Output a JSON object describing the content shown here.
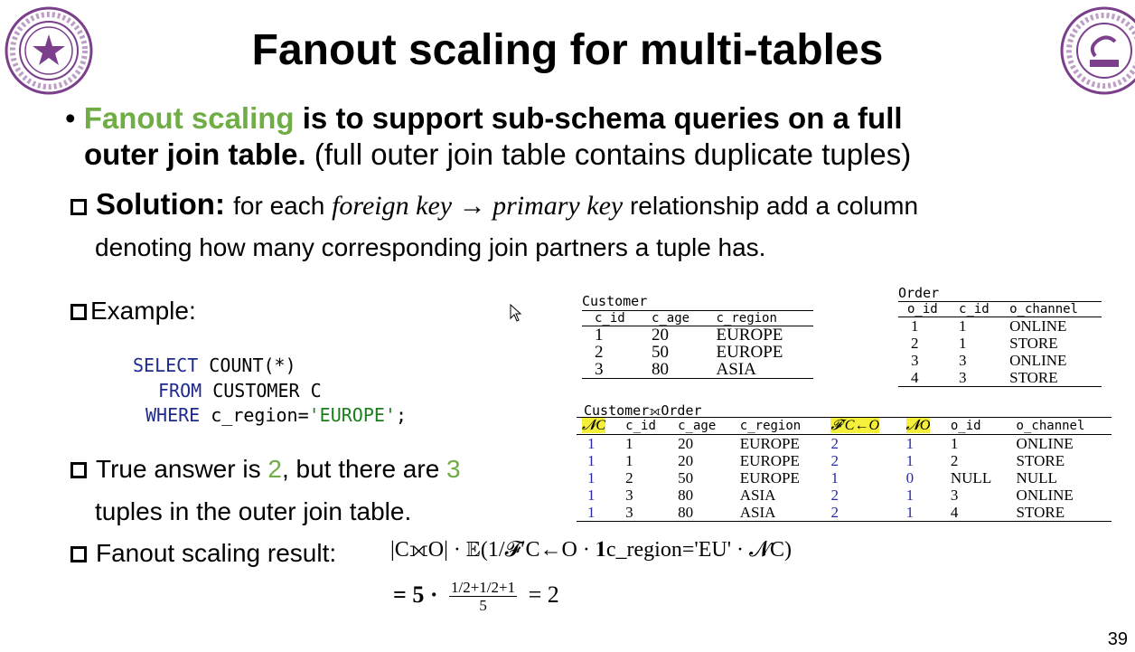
{
  "title": "Fanout scaling for multi-tables",
  "bullet": {
    "highlight": "Fanout scaling",
    "bold_rest": " is to support sub-schema queries on a full",
    "bold_line2": "outer join table.",
    "normal_line2": " (full outer join table contains duplicate tuples)"
  },
  "solution": {
    "label": "Solution:",
    "text_before": "for each ",
    "math": "foreign key → primary key",
    "text_after": " relationship add a column",
    "line2": "denoting how many corresponding join partners a tuple has."
  },
  "example_label": "Example:",
  "sql": {
    "line1_kw": "SELECT",
    "line1_rest": " COUNT(*)",
    "line2_kw": "FROM",
    "line2_rest": " CUSTOMER C",
    "line3_kw": "WHERE",
    "line3_rest": " c_region=",
    "line3_str": "'EUROPE'",
    "line3_end": ";"
  },
  "true_answer": {
    "pre": "True answer is ",
    "n1": "2",
    "mid": ", but there are ",
    "n2": "3",
    "line2": "tuples in the outer join table."
  },
  "fanout_result": {
    "label": "Fanout scaling result:",
    "formula": "|C⟗O| · 𝔼(1/𝓕′C←O · 𝟏c_region='EU' · 𝓝C)",
    "eq": "=  5 ·",
    "num": "1/2+1/2+1",
    "den": "5",
    "result": "= 2"
  },
  "customer_table": {
    "caption": "Customer",
    "headers": [
      "c_id",
      "c_age",
      "c_region"
    ],
    "rows": [
      [
        "1",
        "20",
        "EUROPE"
      ],
      [
        "2",
        "50",
        "EUROPE"
      ],
      [
        "3",
        "80",
        "ASIA"
      ]
    ]
  },
  "order_table": {
    "caption": "Order",
    "headers": [
      "o_id",
      "c_id",
      "o_channel"
    ],
    "rows": [
      [
        "1",
        "1",
        "ONLINE"
      ],
      [
        "2",
        "1",
        "STORE"
      ],
      [
        "3",
        "3",
        "ONLINE"
      ],
      [
        "4",
        "3",
        "STORE"
      ]
    ]
  },
  "join_table": {
    "caption": "Customer⟗Order",
    "headers": [
      "𝓝C",
      "c_id",
      "c_age",
      "c_region",
      "𝓕′C←O",
      "𝓝O",
      "o_id",
      "o_channel"
    ],
    "rows": [
      [
        "1",
        "1",
        "20",
        "EUROPE",
        "2",
        "1",
        "1",
        "ONLINE"
      ],
      [
        "1",
        "1",
        "20",
        "EUROPE",
        "2",
        "1",
        "2",
        "STORE"
      ],
      [
        "1",
        "2",
        "50",
        "EUROPE",
        "1",
        "0",
        "NULL",
        "NULL"
      ],
      [
        "1",
        "3",
        "80",
        "ASIA",
        "2",
        "1",
        "3",
        "ONLINE"
      ],
      [
        "1",
        "3",
        "80",
        "ASIA",
        "2",
        "1",
        "4",
        "STORE"
      ]
    ]
  },
  "page_number": "39",
  "colors": {
    "green": "#70ad47",
    "blue": "#2a2aa8",
    "highlight": "#f5f03a",
    "logo": "#7b3f8c"
  },
  "icons": [
    "tsinghua-university-seal-icon",
    "tsinghua-cs-logo-icon",
    "mouse-cursor-icon"
  ]
}
